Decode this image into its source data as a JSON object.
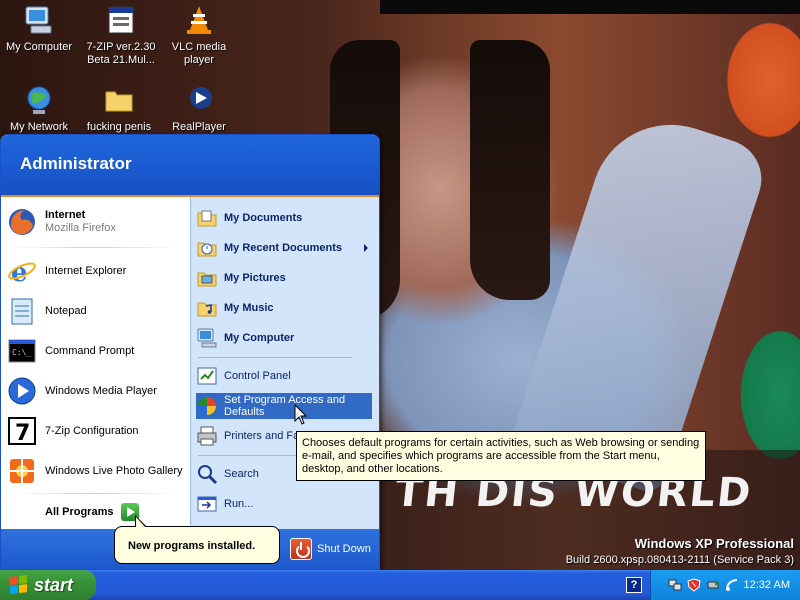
{
  "desktop": {
    "icons": [
      {
        "label": "My Computer",
        "icon": "my-computer-icon"
      },
      {
        "label": "7-ZIP ver.2.30 Beta 21.Mul...",
        "icon": "installer-icon"
      },
      {
        "label": "VLC media player",
        "icon": "vlc-cone-icon"
      },
      {
        "label": "My Network",
        "icon": "network-places-icon"
      },
      {
        "label": "fucking penis",
        "icon": "folder-icon"
      },
      {
        "label": "RealPlayer",
        "icon": "realplayer-icon"
      }
    ],
    "wallpaper_text": "TH DIS WORLD"
  },
  "start_menu": {
    "user": "Administrator",
    "left": {
      "pinned": [
        {
          "title": "Internet",
          "subtitle": "Mozilla Firefox",
          "icon": "firefox-icon"
        }
      ],
      "recent": [
        {
          "title": "Internet Explorer",
          "icon": "internet-explorer-icon"
        },
        {
          "title": "Notepad",
          "icon": "notepad-icon"
        },
        {
          "title": "Command Prompt",
          "icon": "command-prompt-icon"
        },
        {
          "title": "Windows Media Player",
          "icon": "media-player-icon"
        },
        {
          "title": "7-Zip Configuration",
          "icon": "seven-zip-icon"
        },
        {
          "title": "Windows Live Photo Gallery",
          "icon": "photo-gallery-icon"
        }
      ],
      "all_programs": "All Programs"
    },
    "right": {
      "places": [
        {
          "label": "My Documents",
          "icon": "my-documents-icon"
        },
        {
          "label": "My Recent Documents",
          "icon": "recent-documents-icon"
        },
        {
          "label": "My Pictures",
          "icon": "my-pictures-icon"
        },
        {
          "label": "My Music",
          "icon": "my-music-icon"
        },
        {
          "label": "My Computer",
          "icon": "my-computer-icon"
        }
      ],
      "settings": [
        {
          "label": "Control Panel",
          "icon": "control-panel-icon"
        },
        {
          "label": "Set Program Access and Defaults",
          "icon": "program-access-icon"
        },
        {
          "label": "Printers and Fa",
          "icon": "printers-icon"
        }
      ],
      "tools": [
        {
          "label": "Search",
          "icon": "search-icon"
        },
        {
          "label": "Run...",
          "icon": "run-icon"
        }
      ]
    },
    "shutdown_label": "Shut Down"
  },
  "balloon": {
    "text": "New programs installed."
  },
  "tooltip": {
    "text": "Chooses default programs for certain activities, such as Web browsing or sending e-mail, and specifies which programs are accessible from the Start menu, desktop, and other locations."
  },
  "os": {
    "name": "Windows XP Professional",
    "build": "Build 2600.xpsp.080413-2111 (Service Pack 3)"
  },
  "taskbar": {
    "start_label": "start",
    "help": "?",
    "clock": "12:32 AM",
    "tray_icons": [
      "network-status-icon",
      "security-shield-icon",
      "safely-remove-icon",
      "connection-icon"
    ]
  },
  "colors": {
    "xp_blue": "#245edc",
    "start_green": "#389238",
    "highlight": "#316ac5",
    "tooltip_bg": "#ffffe1"
  }
}
